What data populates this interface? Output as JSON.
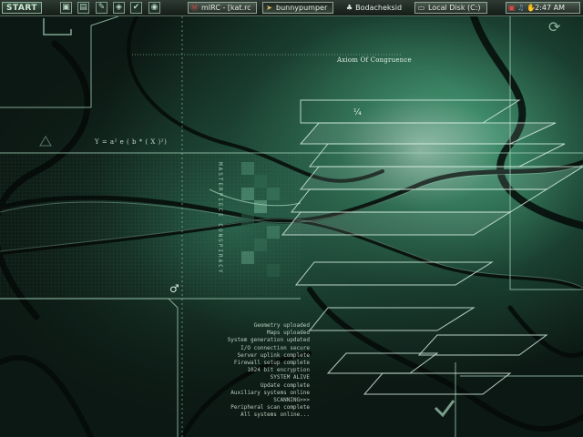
{
  "taskbar": {
    "start_label": "START",
    "quick_launch": [
      {
        "icon": "desktop-icon",
        "glyph": "▣"
      },
      {
        "icon": "folder-icon",
        "glyph": "▤"
      },
      {
        "icon": "pencil-icon",
        "glyph": "✎"
      },
      {
        "icon": "shield-icon",
        "glyph": "◈"
      },
      {
        "icon": "checkmark-icon",
        "glyph": "✔"
      },
      {
        "icon": "browser-icon",
        "glyph": "◉"
      }
    ],
    "windows": [
      {
        "label": "mIRC - [kat.rc",
        "icon": "mirc-icon",
        "glyph": "Ⓜ"
      },
      {
        "label": "bunnypumper",
        "icon": "cursor-icon",
        "glyph": "➤"
      },
      {
        "label": "Bodacheksid",
        "icon": "penguin-icon",
        "glyph": "♣"
      },
      {
        "label": "Local Disk (C:)",
        "icon": "drive-icon",
        "glyph": "▭"
      }
    ],
    "tray": {
      "icons": [
        "network-icon",
        "volume-icon",
        "hand-icon"
      ],
      "clock": "2:47 AM"
    }
  },
  "wallpaper": {
    "title": "Axiom Of Congruence",
    "equation": "Y = a² e ( b * ( X )²)",
    "fraction": "¼",
    "vertical_text": "MASTERPIECE CONSPIRACY",
    "symbol": "♂",
    "log_lines": [
      "Geometry uploaded",
      "Maps uploaded",
      "System generation updated",
      "I/O connection secure",
      "Server uplink complete",
      "Firewall setup complete",
      "1024 bit encryption",
      "SYSTEM ALIVE",
      "Update complete",
      "Auxiliary systems online",
      "SCANNING>>>",
      "Peripheral scan complete",
      "All systems online..."
    ],
    "accent": "#1f6e52"
  }
}
